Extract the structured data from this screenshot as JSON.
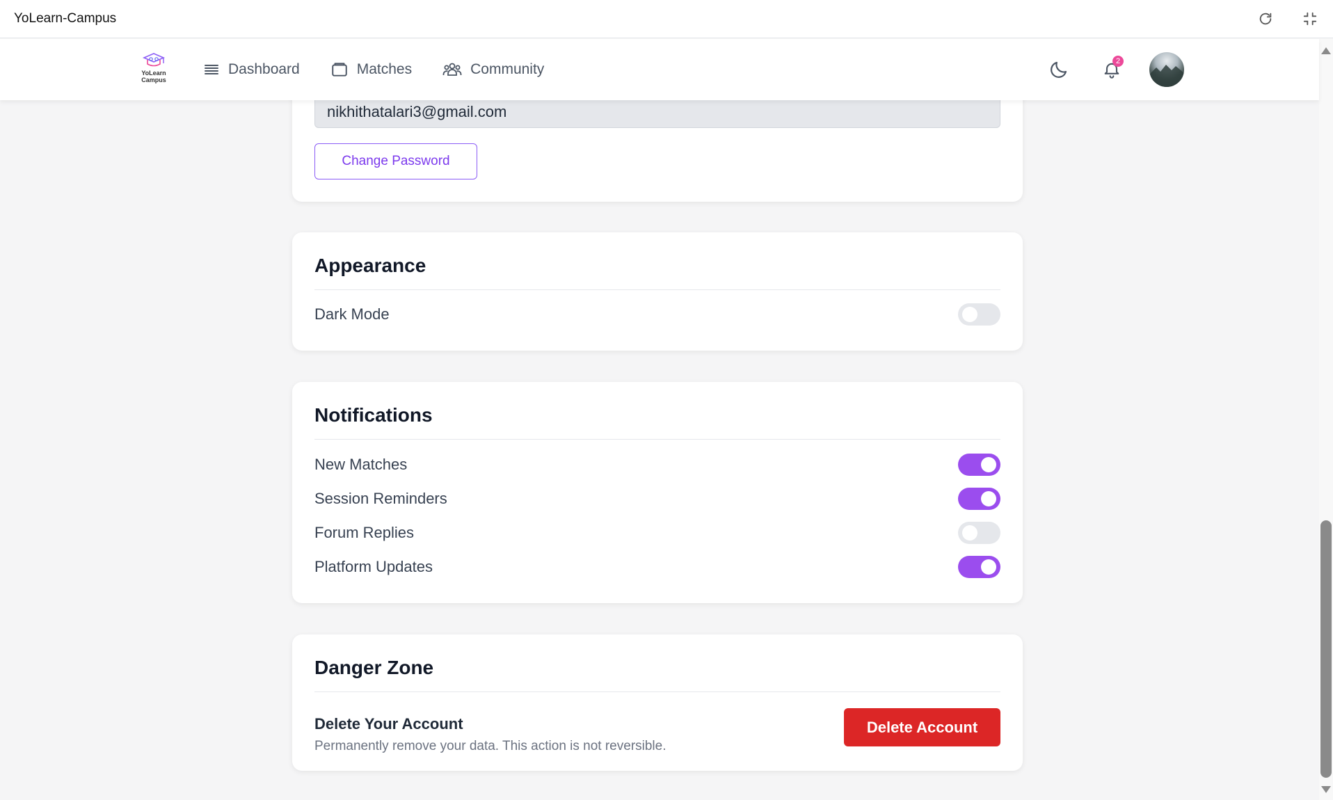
{
  "window": {
    "title": "YoLearn-Campus"
  },
  "navbar": {
    "logo_text_line1": "YoLearn",
    "logo_text_line2": "Campus",
    "links": [
      {
        "label": "Dashboard",
        "icon": "dashboard-icon"
      },
      {
        "label": "Matches",
        "icon": "matches-icon"
      },
      {
        "label": "Community",
        "icon": "community-icon"
      }
    ],
    "notification_count": "2"
  },
  "account": {
    "email": "nikhithatalari3@gmail.com",
    "change_password_label": "Change Password"
  },
  "appearance": {
    "title": "Appearance",
    "dark_mode_label": "Dark Mode",
    "dark_mode_on": false
  },
  "notifications": {
    "title": "Notifications",
    "items": [
      {
        "label": "New Matches",
        "on": true
      },
      {
        "label": "Session Reminders",
        "on": true
      },
      {
        "label": "Forum Replies",
        "on": false
      },
      {
        "label": "Platform Updates",
        "on": true
      }
    ]
  },
  "danger_zone": {
    "title": "Danger Zone",
    "subtitle": "Delete Your Account",
    "description": "Permanently remove your data. This action is not reversible.",
    "delete_button_label": "Delete Account"
  },
  "colors": {
    "accent": "#9b4dee",
    "danger": "#dc2626",
    "badge": "#ec4899"
  }
}
